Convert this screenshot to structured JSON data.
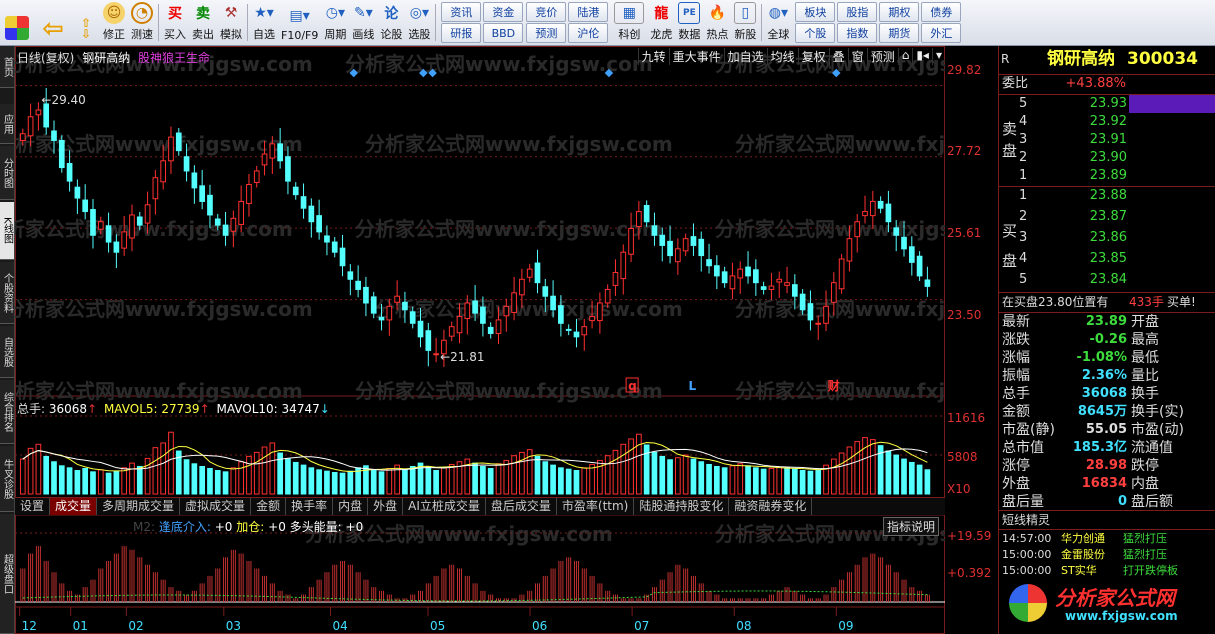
{
  "toolbar": {
    "buttons": [
      "修正",
      "测速",
      "买入",
      "卖出",
      "模拟",
      "自选",
      "F10/F9",
      "周期",
      "画线",
      "论股",
      "选股"
    ],
    "grid1": [
      "资讯",
      "资金",
      "竞价",
      "陆港",
      "研报",
      "BBD",
      "预测",
      "沪伦"
    ],
    "buttons2": [
      "科创",
      "龙虎",
      "数据",
      "热点",
      "新股"
    ],
    "global": "全球",
    "grid2": [
      "板块",
      "股指",
      "期权",
      "债券",
      "个股",
      "指数",
      "期货",
      "外汇"
    ]
  },
  "lefttabs": [
    "首页",
    "应用",
    "分时图",
    "K线图",
    "个股资料",
    "自选股",
    "综合排名",
    "牛叉诊股",
    "超级盘口"
  ],
  "chart": {
    "header_left": "日线(复权)",
    "stock": "钢研高纳",
    "indicator": "股神狼王生命",
    "topbtns": [
      "九转",
      "重大事件",
      "加自选",
      "均线",
      "复权",
      "叠",
      "窗",
      "预测",
      "⌂",
      "▮◂",
      "▾"
    ],
    "high_label": "29.40",
    "low_label": "21.81",
    "price_axis": [
      "29.82",
      "27.72",
      "25.61",
      "23.50"
    ],
    "vol_line": {
      "title": "总手:",
      "v1": "36068",
      "m5": "MAVOL5:",
      "v5": "27739",
      "m10": "MAVOL10:",
      "v10": "34747"
    },
    "vol_axis": [
      "11616",
      "5808",
      "X10"
    ],
    "markers": [
      "q",
      "L",
      "财"
    ],
    "tabs": [
      "设置",
      "成交量",
      "多周期成交量",
      "虚拟成交量",
      "金额",
      "换手率",
      "内盘",
      "外盘",
      "AI立桩成交量",
      "盘后成交量",
      "市盈率(ttm)",
      "陆股通持股变化",
      "融资融券变化"
    ],
    "ind_line": {
      "a": "M2:",
      "b": "逢底介入:",
      "c": "+0",
      "d": "加仓:",
      "e": "+0",
      "f": "多头能量:",
      "g": "+0"
    },
    "ind_btn": "指标说明",
    "ind_axis": [
      "+19.59",
      "+0.392"
    ],
    "months": [
      "12",
      "01",
      "02",
      "03",
      "04",
      "05",
      "06",
      "07",
      "08",
      "09"
    ],
    "watermark": "分析家公式网www.fxjgsw.com"
  },
  "chart_data": {
    "type": "candlestick",
    "y_range": [
      20.8,
      30.4
    ],
    "closes": [
      28.4,
      28.9,
      29.1,
      28.6,
      28.2,
      27.4,
      27.0,
      26.5,
      26.1,
      25.4,
      25.8,
      25.2,
      24.9,
      25.5,
      26.0,
      25.7,
      26.3,
      27.1,
      27.6,
      28.3,
      27.9,
      27.3,
      26.8,
      26.4,
      26.0,
      25.7,
      25.4,
      25.9,
      26.4,
      26.9,
      27.3,
      27.8,
      28.1,
      27.6,
      27.0,
      26.6,
      26.2,
      25.8,
      25.5,
      25.2,
      24.9,
      24.5,
      24.1,
      23.8,
      23.4,
      23.1,
      22.9,
      23.3,
      23.6,
      23.2,
      22.8,
      22.4,
      22.0,
      21.9,
      22.3,
      22.7,
      23.0,
      23.4,
      23.1,
      22.8,
      22.5,
      22.9,
      23.3,
      23.7,
      24.1,
      24.4,
      24.0,
      23.6,
      23.2,
      22.8,
      22.6,
      22.4,
      22.7,
      23.0,
      23.4,
      23.8,
      24.3,
      24.9,
      25.6,
      26.1,
      25.8,
      25.4,
      25.1,
      24.8,
      25.0,
      25.3,
      25.1,
      24.8,
      24.5,
      24.2,
      24.0,
      24.2,
      24.4,
      24.2,
      24.0,
      23.8,
      23.9,
      24.1,
      24.0,
      23.6,
      23.2,
      22.9,
      22.8,
      23.3,
      24.0,
      24.7,
      25.3,
      25.8,
      26.1,
      26.4,
      26.2,
      25.8,
      25.4,
      25.0,
      24.6,
      24.2,
      23.89
    ],
    "volume_range": [
      0,
      11616
    ],
    "volumes": [
      5200,
      6800,
      7400,
      5600,
      4800,
      4200,
      3900,
      3500,
      3800,
      3300,
      3600,
      3100,
      3400,
      3900,
      4600,
      4100,
      5300,
      6900,
      7600,
      9200,
      6400,
      5100,
      4500,
      4100,
      3800,
      3500,
      3300,
      3900,
      4800,
      5600,
      6200,
      7000,
      7600,
      6100,
      5200,
      4700,
      4300,
      3900,
      3600,
      3400,
      3200,
      3100,
      3400,
      3900,
      4200,
      3600,
      3300,
      3800,
      4300,
      3700,
      4100,
      4600,
      4000,
      3500,
      3900,
      4400,
      4800,
      5200,
      4600,
      4100,
      3800,
      4500,
      5000,
      5700,
      6200,
      6600,
      5600,
      4800,
      4300,
      3900,
      3700,
      3500,
      3900,
      4400,
      5000,
      5700,
      6500,
      7400,
      8200,
      8900,
      7300,
      6200,
      5600,
      5100,
      5400,
      5800,
      5200,
      4800,
      4400,
      4100,
      3900,
      4200,
      4500,
      4200,
      3900,
      3700,
      3800,
      4000,
      3900,
      3700,
      3500,
      3400,
      3600,
      4300,
      5200,
      6100,
      7000,
      7800,
      8400,
      8100,
      7200,
      6400,
      5800,
      5200,
      4700,
      4300,
      3606
    ],
    "indicator_range": [
      0,
      19.59
    ],
    "indicator": [
      9,
      13,
      15,
      11,
      8,
      5,
      3,
      2,
      4,
      6,
      9,
      11,
      13,
      15,
      14,
      12,
      10,
      8,
      6,
      4,
      3,
      2,
      3,
      5,
      7,
      9,
      12,
      14,
      13,
      11,
      9,
      7,
      5,
      3,
      2,
      1,
      2,
      4,
      6,
      8,
      10,
      11,
      10,
      8,
      6,
      4,
      3,
      2,
      1,
      1,
      2,
      3,
      5,
      7,
      9,
      10,
      9,
      7,
      5,
      3,
      2,
      1,
      1,
      1,
      2,
      3,
      5,
      7,
      9,
      11,
      12,
      11,
      9,
      7,
      5,
      3,
      2,
      1,
      1,
      1,
      2,
      4,
      6,
      8,
      10,
      9,
      7,
      5,
      3,
      2,
      1,
      1,
      1,
      1,
      1,
      1,
      2,
      3,
      4,
      3,
      2,
      1,
      1,
      2,
      4,
      6,
      8,
      10,
      12,
      13,
      12,
      10,
      8,
      6,
      4,
      3,
      2
    ]
  },
  "right_panel": {
    "header": {
      "r": "R",
      "name": "钢研高纳",
      "code": "300034"
    },
    "weibi": {
      "label": "委比",
      "value": "+43.88%"
    },
    "sell_label": [
      "卖",
      "盘"
    ],
    "buy_label": [
      "买",
      "盘"
    ],
    "asks": [
      {
        "n": "5",
        "p": "23.93"
      },
      {
        "n": "4",
        "p": "23.92"
      },
      {
        "n": "3",
        "p": "23.91"
      },
      {
        "n": "2",
        "p": "23.90"
      },
      {
        "n": "1",
        "p": "23.89"
      }
    ],
    "bids": [
      {
        "n": "1",
        "p": "23.88"
      },
      {
        "n": "2",
        "p": "23.87"
      },
      {
        "n": "3",
        "p": "23.86"
      },
      {
        "n": "4",
        "p": "23.85"
      },
      {
        "n": "5",
        "p": "23.84"
      }
    ],
    "alert": {
      "t": "在买盘23.80位置有",
      "q": "433手",
      "s": "买单!"
    },
    "stats": [
      [
        "最新",
        "23.89",
        "开盘"
      ],
      [
        "涨跌",
        "-0.26",
        "最高"
      ],
      [
        "涨幅",
        "-1.08%",
        "最低"
      ],
      [
        "振幅",
        "2.36%",
        "量比"
      ],
      [
        "总手",
        "36068",
        "换手"
      ],
      [
        "金额",
        "8645万",
        "换手(实)"
      ],
      [
        "市盈(静)",
        "55.05",
        "市盈(动)"
      ],
      [
        "总市值",
        "185.3亿",
        "流通值"
      ],
      [
        "涨停",
        "28.98",
        "跌停"
      ],
      [
        "外盘",
        "16834",
        "内盘"
      ],
      [
        "盘后量",
        "0",
        "盘后额"
      ]
    ],
    "sprite_title": "短线精灵",
    "sprite": [
      {
        "t": "14:57:00",
        "n": "华力创通",
        "e": "猛烈打压"
      },
      {
        "t": "15:00:00",
        "n": "金雷股份",
        "e": "猛烈打压"
      },
      {
        "t": "15:00:00",
        "n": "ST实华",
        "e": "打开跌停板"
      }
    ],
    "logo": "分析家公式网",
    "logo_url": "www.fxjgsw.com"
  }
}
